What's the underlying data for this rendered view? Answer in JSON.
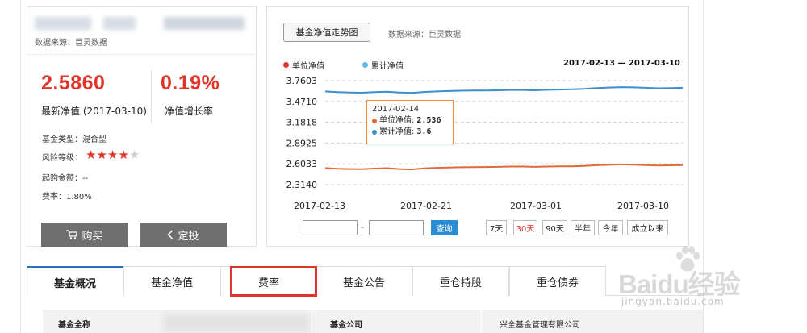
{
  "left_panel": {
    "data_source": "数据来源：巨灵数据",
    "latest_nav": "2.5860",
    "latest_nav_caption": "最新净值 (2017-03-10)",
    "growth_rate": "0.19%",
    "growth_rate_caption": "净值增长率",
    "fund_type_label": "基金类型：",
    "fund_type_value": "混合型",
    "risk_label": "风险等级：",
    "risk_rating": 4,
    "risk_rating_max": 5,
    "min_purchase_label": "起购金额：",
    "min_purchase_value": "--",
    "fee_label": "费率：",
    "fee_value": "1.80%",
    "buy_label": "购买",
    "invest_label": "定投"
  },
  "chart_panel": {
    "title_button": "基金净值走势图",
    "data_source": "数据来源：巨灵数据",
    "date_dash": "-",
    "query_label": "查询",
    "range_buttons": [
      "7天",
      "30天",
      "90天",
      "半年",
      "今年",
      "成立以来"
    ],
    "active_range": "30天",
    "tooltip": {
      "date": "2017-02-14",
      "unit_label": "单位净值:",
      "unit_value": "2.536",
      "acc_label": "累计净值:",
      "acc_value": "3.6"
    }
  },
  "chart_data": {
    "type": "line",
    "date_range": "2017-02-13 — 2017-03-10",
    "y_ticks": [
      "3.7603",
      "3.4710",
      "3.1818",
      "2.8925",
      "2.6033",
      "2.3140"
    ],
    "ylim": [
      2.314,
      3.7603
    ],
    "x_ticks": [
      "2017-02-13",
      "2017-02-21",
      "2017-03-01",
      "2017-03-10"
    ],
    "grid": true,
    "legend_position": "top-left",
    "series": [
      {
        "name": "单位净值",
        "color": "#e06a3a",
        "values": [
          2.545,
          2.536,
          2.532,
          2.53,
          2.538,
          2.544,
          2.532,
          2.526,
          2.54,
          2.548,
          2.552,
          2.556,
          2.558,
          2.56,
          2.562,
          2.566,
          2.566,
          2.562,
          2.566,
          2.568,
          2.57,
          2.575,
          2.584,
          2.59,
          2.595,
          2.592,
          2.585,
          2.58,
          2.583,
          2.586
        ]
      },
      {
        "name": "累计净值",
        "color": "#3a8fd0",
        "values": [
          3.61,
          3.6,
          3.596,
          3.592,
          3.6,
          3.606,
          3.596,
          3.59,
          3.602,
          3.61,
          3.616,
          3.62,
          3.622,
          3.624,
          3.626,
          3.63,
          3.63,
          3.626,
          3.632,
          3.636,
          3.64,
          3.646,
          3.656,
          3.664,
          3.67,
          3.666,
          3.66,
          3.654,
          3.656,
          3.66
        ]
      }
    ]
  },
  "tabs": [
    "基金概况",
    "基金净值",
    "费率",
    "基金公告",
    "重仓持股",
    "重仓债券"
  ],
  "active_tab": "基金概况",
  "highlighted_tab": "费率",
  "table": {
    "label1": "基金全称",
    "label2": "基金公司",
    "value2": "兴全基金管理有限公司"
  },
  "watermark": {
    "main": "Baidu经验",
    "sub": "jingyan.baidu.com"
  },
  "colors": {
    "accent_red": "#e0342a",
    "query_blue": "#2a8dd4",
    "button_gray": "#6f6f6f"
  }
}
